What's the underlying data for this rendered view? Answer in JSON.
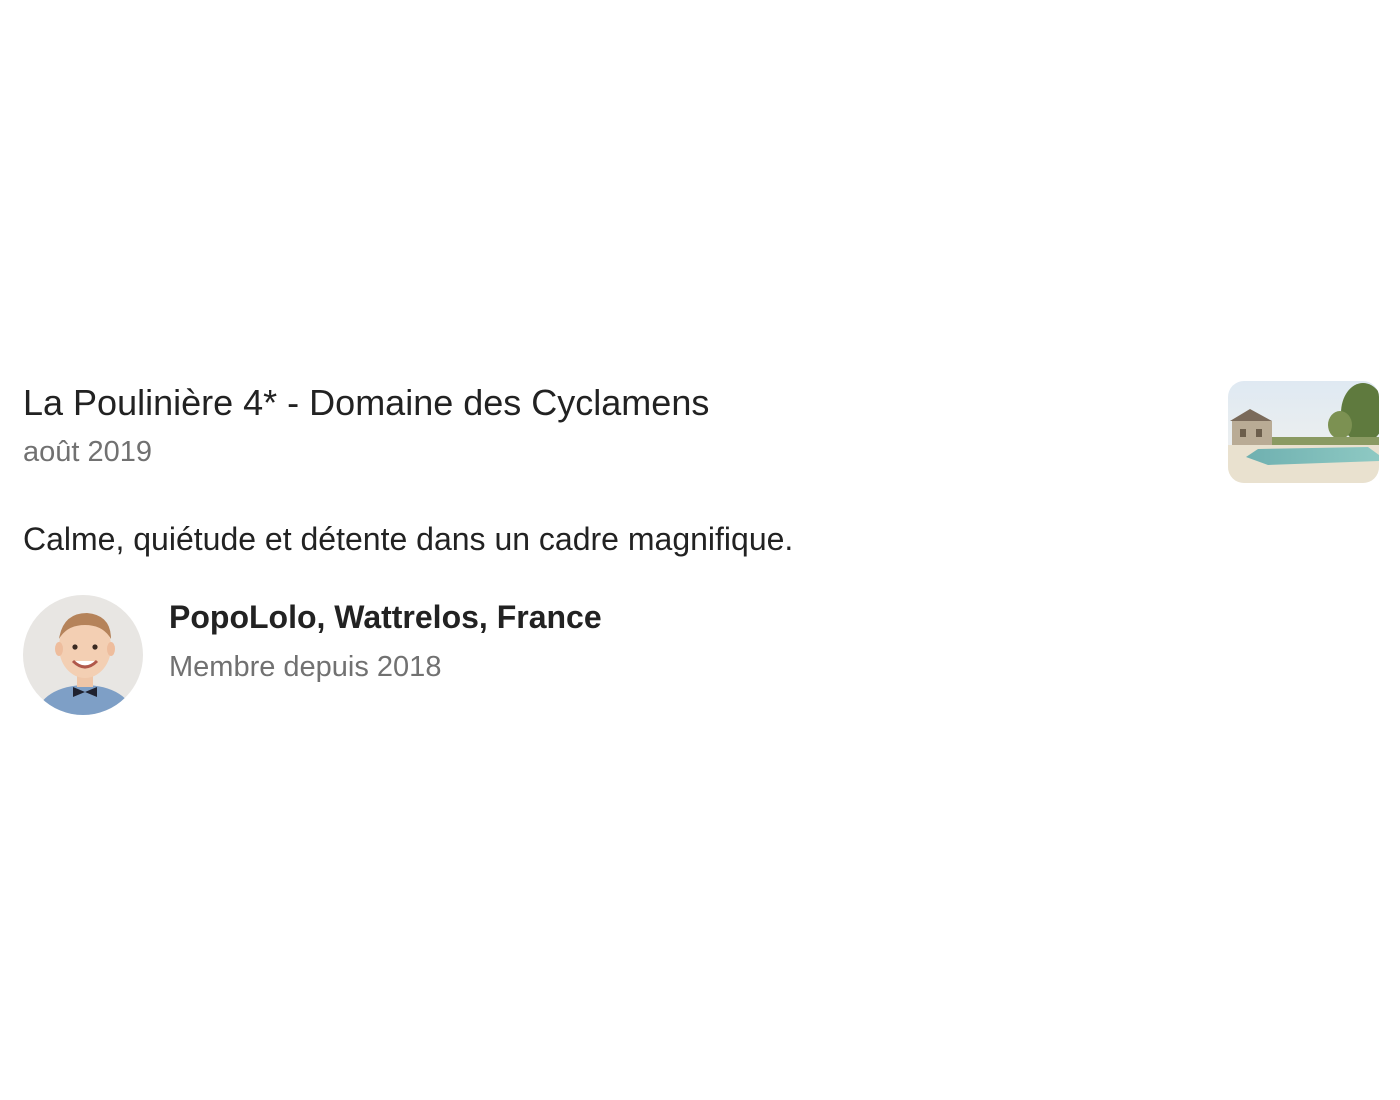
{
  "review": {
    "listing_title": "La Poulinière 4* - Domaine des Cyclamens",
    "date": "août 2019",
    "text": "Calme, quiétude et détente dans un cadre magnifique.",
    "listing_thumbnail_icon": "pool-photo",
    "reviewer": {
      "name": "PopoLolo, Wattrelos, France",
      "member_since": "Membre depuis 2018",
      "avatar_icon": "child-portrait-photo"
    }
  },
  "colors": {
    "primary_text": "#222222",
    "secondary_text": "#717171",
    "background": "#ffffff"
  }
}
